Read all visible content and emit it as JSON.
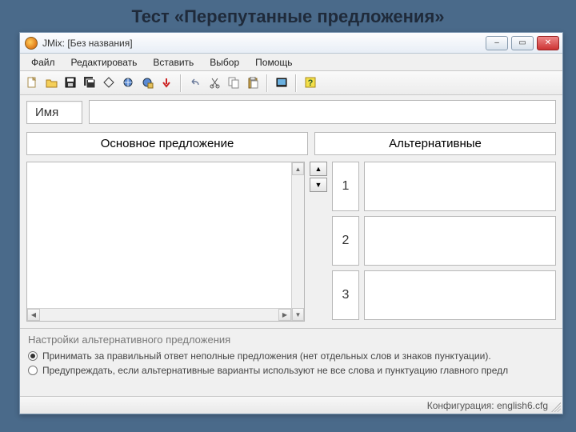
{
  "slide": {
    "title": "Тест «Перепутанные предложения»"
  },
  "window": {
    "title": "JMix: [Без названия]",
    "controls": {
      "min": "–",
      "max": "▭",
      "close": "✕"
    }
  },
  "menu": {
    "items": [
      "Файл",
      "Редактировать",
      "Вставить",
      "Выбор",
      "Помощь"
    ]
  },
  "toolbar": {
    "groups": [
      [
        "new",
        "open",
        "save",
        "saveall",
        "diamond",
        "web1",
        "web2",
        "down"
      ],
      [
        "undo",
        "cut",
        "copy",
        "paste"
      ],
      [
        "screen"
      ],
      [
        "help"
      ]
    ]
  },
  "labels": {
    "name": "Имя",
    "main_sentence": "Основное предложение",
    "alternatives": "Альтернативные"
  },
  "inputs": {
    "name_value": ""
  },
  "alternatives": [
    {
      "index": "1",
      "text": ""
    },
    {
      "index": "2",
      "text": ""
    },
    {
      "index": "3",
      "text": ""
    }
  ],
  "settings": {
    "title": "Настройки альтернативного предложения",
    "opt1": "Принимать за правильный ответ неполные предложения (нет отдельных слов и знаков пунктуации).",
    "opt2": "Предупреждать, если альтернативные варианты используют не все слова и пунктуацию главного предл",
    "selected": 0
  },
  "status": {
    "config": "Конфигурация: english6.cfg"
  },
  "icons": {
    "new": "new-file-icon",
    "open": "open-folder-icon",
    "save": "save-icon",
    "saveall": "save-all-icon",
    "diamond": "diamond-icon",
    "web1": "web-export-icon",
    "web2": "web-package-icon",
    "down": "red-arrow-down-icon",
    "undo": "undo-icon",
    "cut": "cut-icon",
    "copy": "copy-icon",
    "paste": "paste-icon",
    "screen": "preview-icon",
    "help": "help-icon"
  }
}
